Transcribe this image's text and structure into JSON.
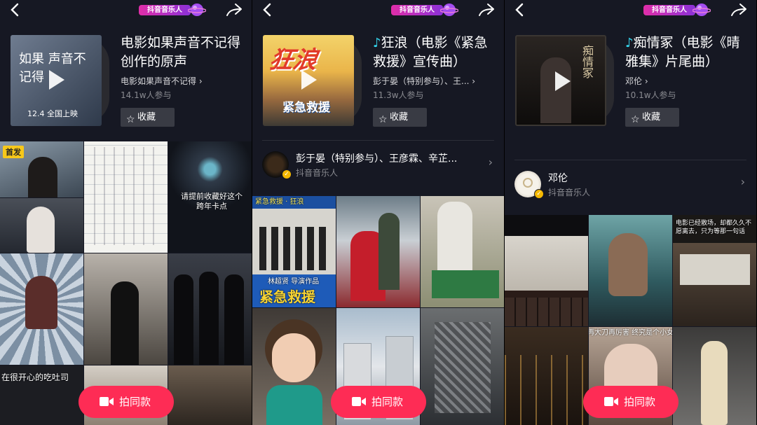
{
  "brand": {
    "label": "抖音音乐人"
  },
  "actions": {
    "favorite": "收藏",
    "shoot_same": "拍同款"
  },
  "screens": [
    {
      "title": "电影如果声音不记得创作的原声",
      "artist": "电影如果声音不记得",
      "count": "14.1w人参与",
      "cover_text": "如果 声音不记得",
      "cover_date": "12.4 全国上映",
      "badge": "首发",
      "captions": [
        "请提前收藏好这个跨年卡点",
        "在很开心的吃吐司"
      ]
    },
    {
      "title": "狂浪（电影《紧急救援》宣传曲）",
      "artist": "彭于晏（特别参与）、王...",
      "count": "11.3w人参与",
      "cover_text": "狂浪",
      "cover_sub": "紧急救援",
      "owner_name": "彭于晏（特别参与）、王彦霖、辛芷...",
      "owner_role": "抖音音乐人",
      "captions": [
        "紧急救援 · 狂浪",
        "林超贤 导演作品",
        "紧急救援"
      ]
    },
    {
      "title": "痴情冢（电影《晴雅集》片尾曲）",
      "artist": "邓伦",
      "count": "10.1w人参与",
      "cover_text": "痴情冢",
      "owner_name": "邓伦",
      "owner_role": "抖音音乐人",
      "captions": [
        "电影已经散场，却都久久不愿离去，只为等那一句话",
        "再大刀再厉害 终究是个小女孩"
      ]
    }
  ]
}
